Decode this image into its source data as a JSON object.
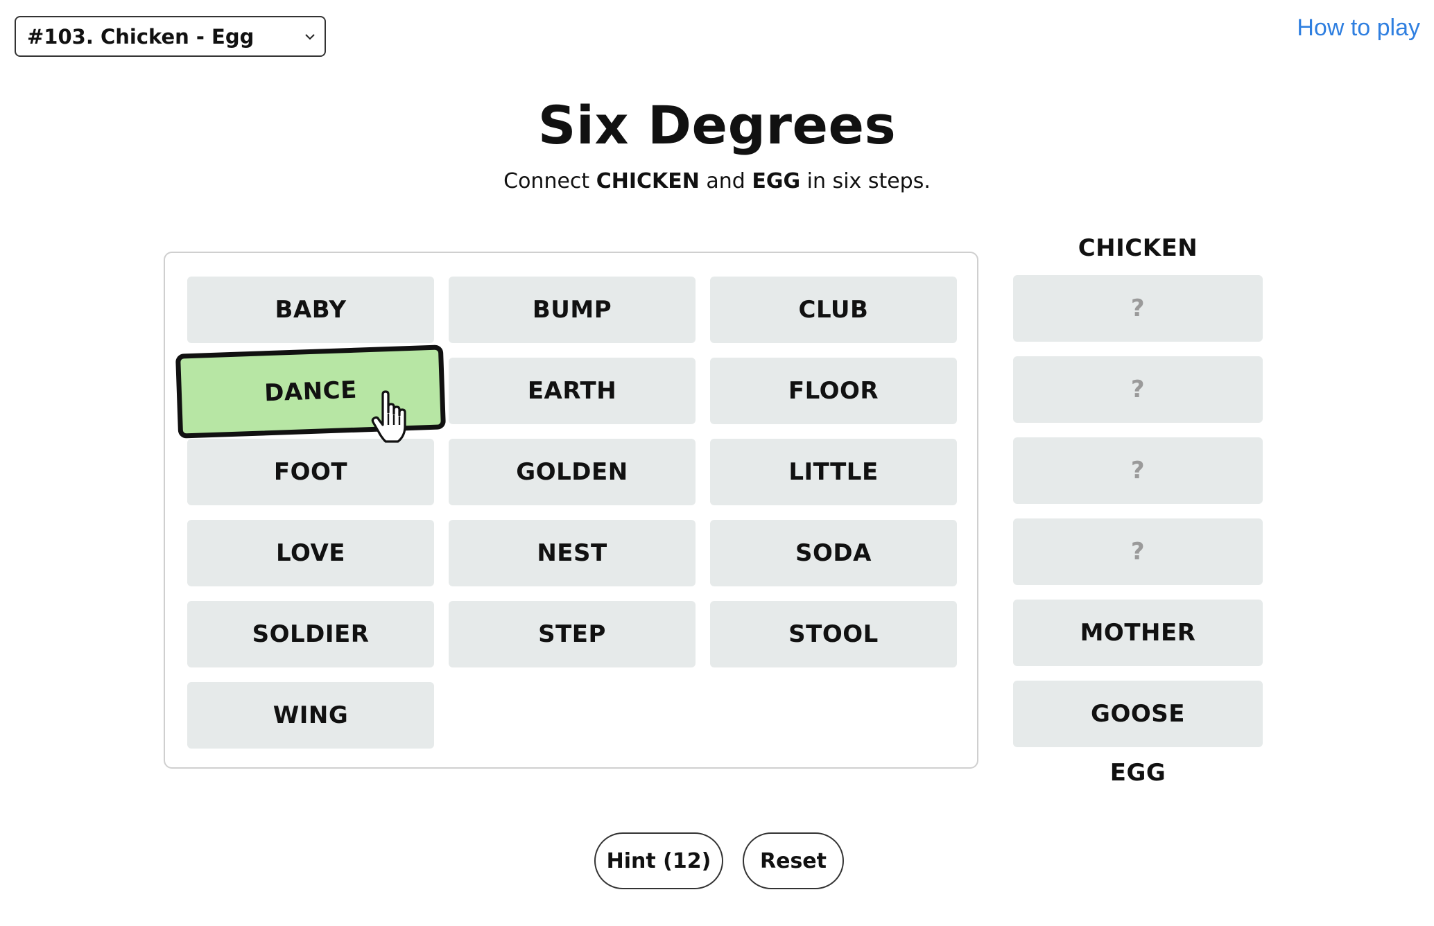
{
  "header": {
    "puzzle_selector_value": "#103. Chicken - Egg",
    "how_to_play": "How to play"
  },
  "title": "Six Degrees",
  "subtitle": {
    "prefix": "Connect ",
    "start_word": "CHICKEN",
    "middle": " and ",
    "end_word": "EGG",
    "suffix": " in six steps."
  },
  "grid": {
    "words": [
      "BABY",
      "BUMP",
      "CLUB",
      "DANCE",
      "EARTH",
      "FLOOR",
      "FOOT",
      "GOLDEN",
      "LITTLE",
      "LOVE",
      "NEST",
      "SODA",
      "SOLDIER",
      "STEP",
      "STOOL",
      "WING"
    ],
    "selected": "DANCE"
  },
  "chain": {
    "start_label": "CHICKEN",
    "slots": [
      "?",
      "?",
      "?",
      "?",
      "MOTHER",
      "GOOSE"
    ],
    "end_label": "EGG"
  },
  "buttons": {
    "hint": "Hint (12)",
    "reset": "Reset"
  },
  "colors": {
    "link": "#2f7fe0",
    "tile_bg": "#e6eaea",
    "selected_tile_bg": "#b7e6a4",
    "placeholder_text": "#9a9a9a"
  }
}
